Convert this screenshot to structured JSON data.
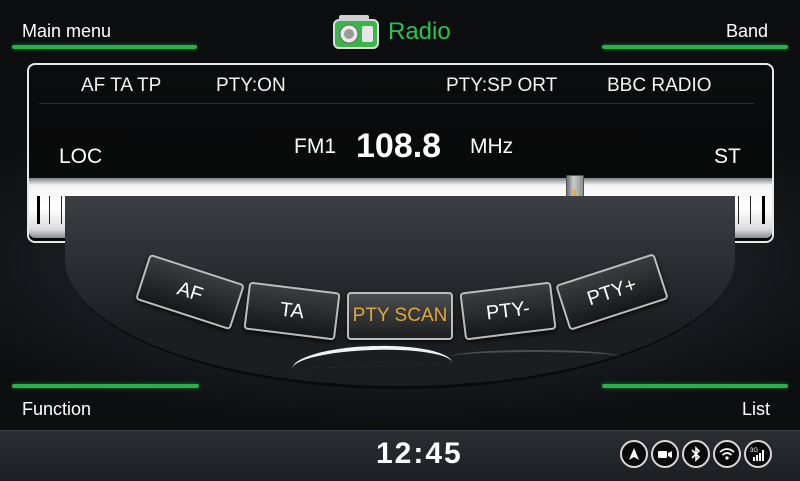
{
  "header": {
    "title": "Radio",
    "left_label": "Main menu",
    "right_label": "Band",
    "icon": "radio-icon"
  },
  "footer_labels": {
    "left": "Function",
    "right": "List"
  },
  "info": {
    "flags": "AF TA TP",
    "pty_status": "PTY:ON",
    "pty_type": "PTY:SP ORT",
    "station": "BBC RADIO"
  },
  "tuner": {
    "band": "FM1",
    "frequency": "108.8",
    "unit": "MHz",
    "loc": "LOC",
    "stereo": "ST",
    "dial_position_fraction": 0.74
  },
  "buttons": [
    {
      "label": "AF"
    },
    {
      "label": "TA"
    },
    {
      "label": "PTY SCAN"
    },
    {
      "label": "PTY-"
    },
    {
      "label": "PTY+"
    }
  ],
  "status_bar": {
    "time": "12:45",
    "icons": [
      "navigation-icon",
      "camera-icon",
      "bluetooth-icon",
      "wifi-icon",
      "cellular-3g-icon"
    ]
  },
  "colors": {
    "accent_green": "#23b34a",
    "active_button_text": "#e0a73a",
    "needle": "#ffa800"
  }
}
